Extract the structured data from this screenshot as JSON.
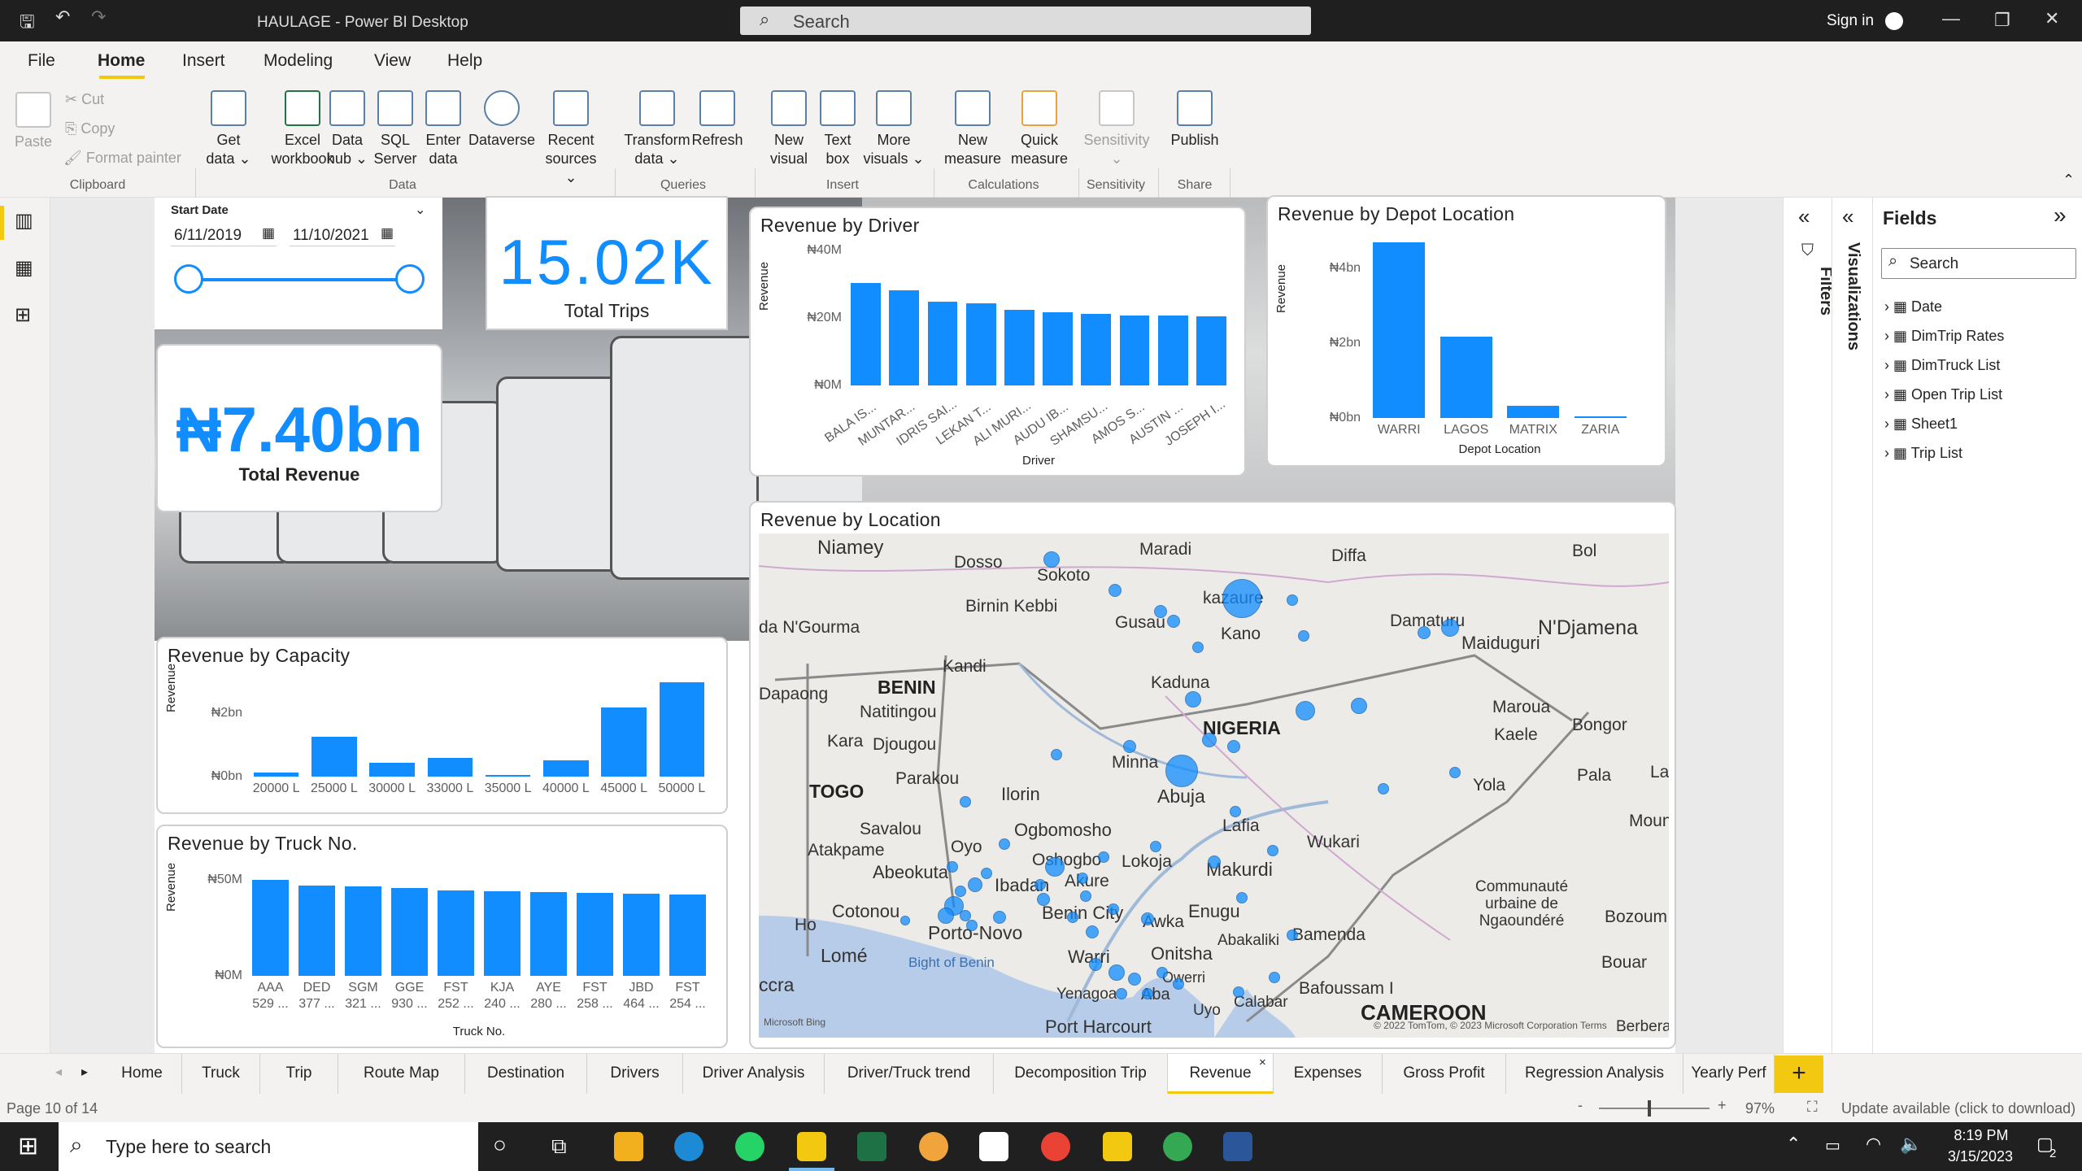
{
  "titlebar": {
    "title": "HAULAGE - Power BI Desktop",
    "search_placeholder": "Search",
    "sign_in": "Sign in"
  },
  "menu": [
    "File",
    "Home",
    "Insert",
    "Modeling",
    "View",
    "Help"
  ],
  "ribbon": {
    "clipboard": {
      "paste": "Paste",
      "cut": "Cut",
      "copy": "Copy",
      "format_painter": "Format painter",
      "group": "Clipboard"
    },
    "data": {
      "get_data": "Get data",
      "excel": "Excel workbook",
      "data_hub": "Data hub",
      "sql": "SQL Server",
      "enter_data": "Enter data",
      "dataverse": "Dataverse",
      "recent": "Recent sources",
      "group": "Data"
    },
    "queries": {
      "transform": "Transform data",
      "refresh": "Refresh",
      "group": "Queries"
    },
    "insert": {
      "new_visual": "New visual",
      "text_box": "Text box",
      "more_visuals": "More visuals",
      "group": "Insert"
    },
    "calculations": {
      "new_measure": "New measure",
      "quick_measure": "Quick measure",
      "group": "Calculations"
    },
    "sensitivity": {
      "label": "Sensitivity",
      "group": "Sensitivity"
    },
    "share": {
      "publish": "Publish",
      "group": "Share"
    }
  },
  "slicer": {
    "title": "Start Date",
    "start": "6/11/2019",
    "end": "11/10/2021"
  },
  "kpi_trips": {
    "value": "15.02K",
    "label": "Total Trips"
  },
  "kpi_revenue": {
    "value": "₦7.40bn",
    "label": "Total Revenue"
  },
  "charts": {
    "driver": {
      "title": "Revenue by Driver",
      "xlabel": "Driver",
      "ylabel": "Revenue",
      "yticks": [
        "₦40M",
        "₦20M",
        "₦0M"
      ],
      "categories": [
        "BALA IS...",
        "MUNTAR...",
        "IDRIS SAI...",
        "LEKAN T...",
        "ALI MURI...",
        "AUDU IB...",
        "SHAMSU...",
        "AMOS S...",
        "AUSTIN ...",
        "JOSEPH I..."
      ],
      "values": [
        35,
        32.5,
        28.5,
        28,
        25.8,
        25,
        24.5,
        24,
        23.8,
        23.7
      ],
      "ymax": 40
    },
    "depot": {
      "title": "Revenue by Depot Location",
      "xlabel": "Depot Location",
      "ylabel": "Revenue",
      "yticks": [
        "₦4bn",
        "₦2bn",
        "₦0bn"
      ],
      "categories": [
        "WARRI",
        "LAGOS",
        "MATRIX",
        "ZARIA"
      ],
      "values": [
        4.85,
        2.25,
        0.33,
        0.05
      ],
      "ymax": 4.9
    },
    "capacity": {
      "title": "Revenue by Capacity",
      "ylabel": "Revenue",
      "yticks": [
        "₦2bn",
        "₦0bn"
      ],
      "categories": [
        "20000 L",
        "25000 L",
        "30000 L",
        "33000 L",
        "35000 L",
        "40000 L",
        "45000 L",
        "50000 L"
      ],
      "values": [
        0.12,
        1.12,
        0.38,
        0.52,
        0.05,
        0.45,
        1.95,
        2.65
      ],
      "ymax": 2.7
    },
    "truck": {
      "title": "Revenue by Truck No.",
      "xlabel": "Truck No.",
      "ylabel": "Revenue",
      "yticks": [
        "₦50M",
        "₦0M"
      ],
      "categories": [
        "AAA",
        "DED",
        "SGM",
        "GGE",
        "FST",
        "KJA",
        "AYE",
        "FST",
        "JBD",
        "FST"
      ],
      "sublabels": [
        "529 ...",
        "377 ...",
        "321 ...",
        "930 ...",
        "252 ...",
        "240 ...",
        "280 ...",
        "258 ...",
        "464 ...",
        "254 ..."
      ],
      "values": [
        53,
        50,
        49.5,
        48.5,
        47,
        46.5,
        46.3,
        46,
        45.5,
        45
      ],
      "ymax": 53
    }
  },
  "map": {
    "title": "Revenue by Location",
    "labels": [
      "Niamey",
      "Sokoto",
      "Maradi",
      "Diffa",
      "Bol",
      "Dosso",
      "Birnin Kebbi",
      "kazaure",
      "Kano",
      "Damaturu",
      "Maiduguri",
      "N'Djamena",
      "da N'Gourma",
      "Gusau",
      "Kandi",
      "BENIN",
      "Kaduna",
      "Natitingou",
      "Dapaong",
      "NIGERIA",
      "Maroua",
      "Kaele",
      "Bongor",
      "Kara",
      "Djougou",
      "Minna",
      "Parakou",
      "Yola",
      "Pala",
      "TOGO",
      "Ilorin",
      "Abuja",
      "Lafia",
      "Savalou",
      "Oyo",
      "Ogbomosho",
      "Mound",
      "Atakpame",
      "Abeokuta",
      "Oshogbo",
      "Lokoja",
      "Makurdi",
      "Wukari",
      "Ibadan",
      "Akure",
      "Communauté urbaine de Ngaoundéré",
      "Cotonou",
      "Benin City",
      "Enugu",
      "Ho",
      "Porto-Novo",
      "Awka",
      "Abakaliki",
      "Bamenda",
      "Bozoum",
      "Lomé",
      "Onitsha",
      "Bight of Benin",
      "Warri",
      "Bouar",
      "ccra",
      "Bafoussam I",
      "Yenagoa",
      "Aba",
      "Owerri",
      "Calabar",
      "Uyo",
      "Port Harcourt",
      "CAMEROON",
      "Berberati",
      "La",
      "Microsoft Bing",
      "© 2022 TomTom, © 2023 Microsoft Corporation  Terms"
    ]
  },
  "fields": {
    "title": "Fields",
    "search": "Search",
    "items": [
      "Date",
      "DimTrip Rates",
      "DimTruck List",
      "Open Trip List",
      "Sheet1",
      "Trip List"
    ]
  },
  "panes": {
    "filters": "Filters",
    "visualizations": "Visualizations"
  },
  "tabs": [
    "Home",
    "Truck",
    "Trip",
    "Route Map",
    "Destination",
    "Drivers",
    "Driver Analysis",
    "Driver/Truck trend",
    "Decomposition Trip",
    "Revenue",
    "Expenses",
    "Gross Profit",
    "Regression Analysis",
    "Yearly Perf"
  ],
  "status": {
    "page": "Page 10 of 14",
    "zoom": "97%",
    "update": "Update available (click to download)"
  },
  "taskbar": {
    "search": "Type here to search",
    "time": "8:19 PM",
    "date": "3/15/2023",
    "notif": "2"
  }
}
